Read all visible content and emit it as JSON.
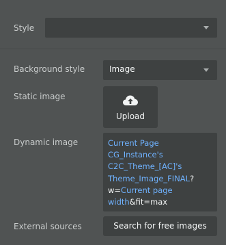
{
  "style_row": {
    "label": "Style",
    "value": ""
  },
  "background_style": {
    "label": "Background style",
    "value": "Image"
  },
  "static_image": {
    "label": "Static image",
    "upload_label": "Upload",
    "upload_icon": "cloud-upload-icon"
  },
  "dynamic_image": {
    "label": "Dynamic image",
    "segments": [
      {
        "kind": "token",
        "text": " Current Page CG_Instance's C2C_Theme_[AC]'s Theme_Image_FINAL"
      },
      {
        "kind": "text",
        "text": "?w="
      },
      {
        "kind": "token",
        "text": "Current page width"
      },
      {
        "kind": "text",
        "text": "&fit=max"
      }
    ]
  },
  "external_sources": {
    "label": "External sources",
    "button_label": "Search for free images"
  },
  "colors": {
    "panel_bg": "#505353",
    "field_bg": "#3e4141",
    "label_text": "#c9cccc",
    "value_text": "#f2f4f4",
    "dynamic_token": "#6fb2ff"
  }
}
